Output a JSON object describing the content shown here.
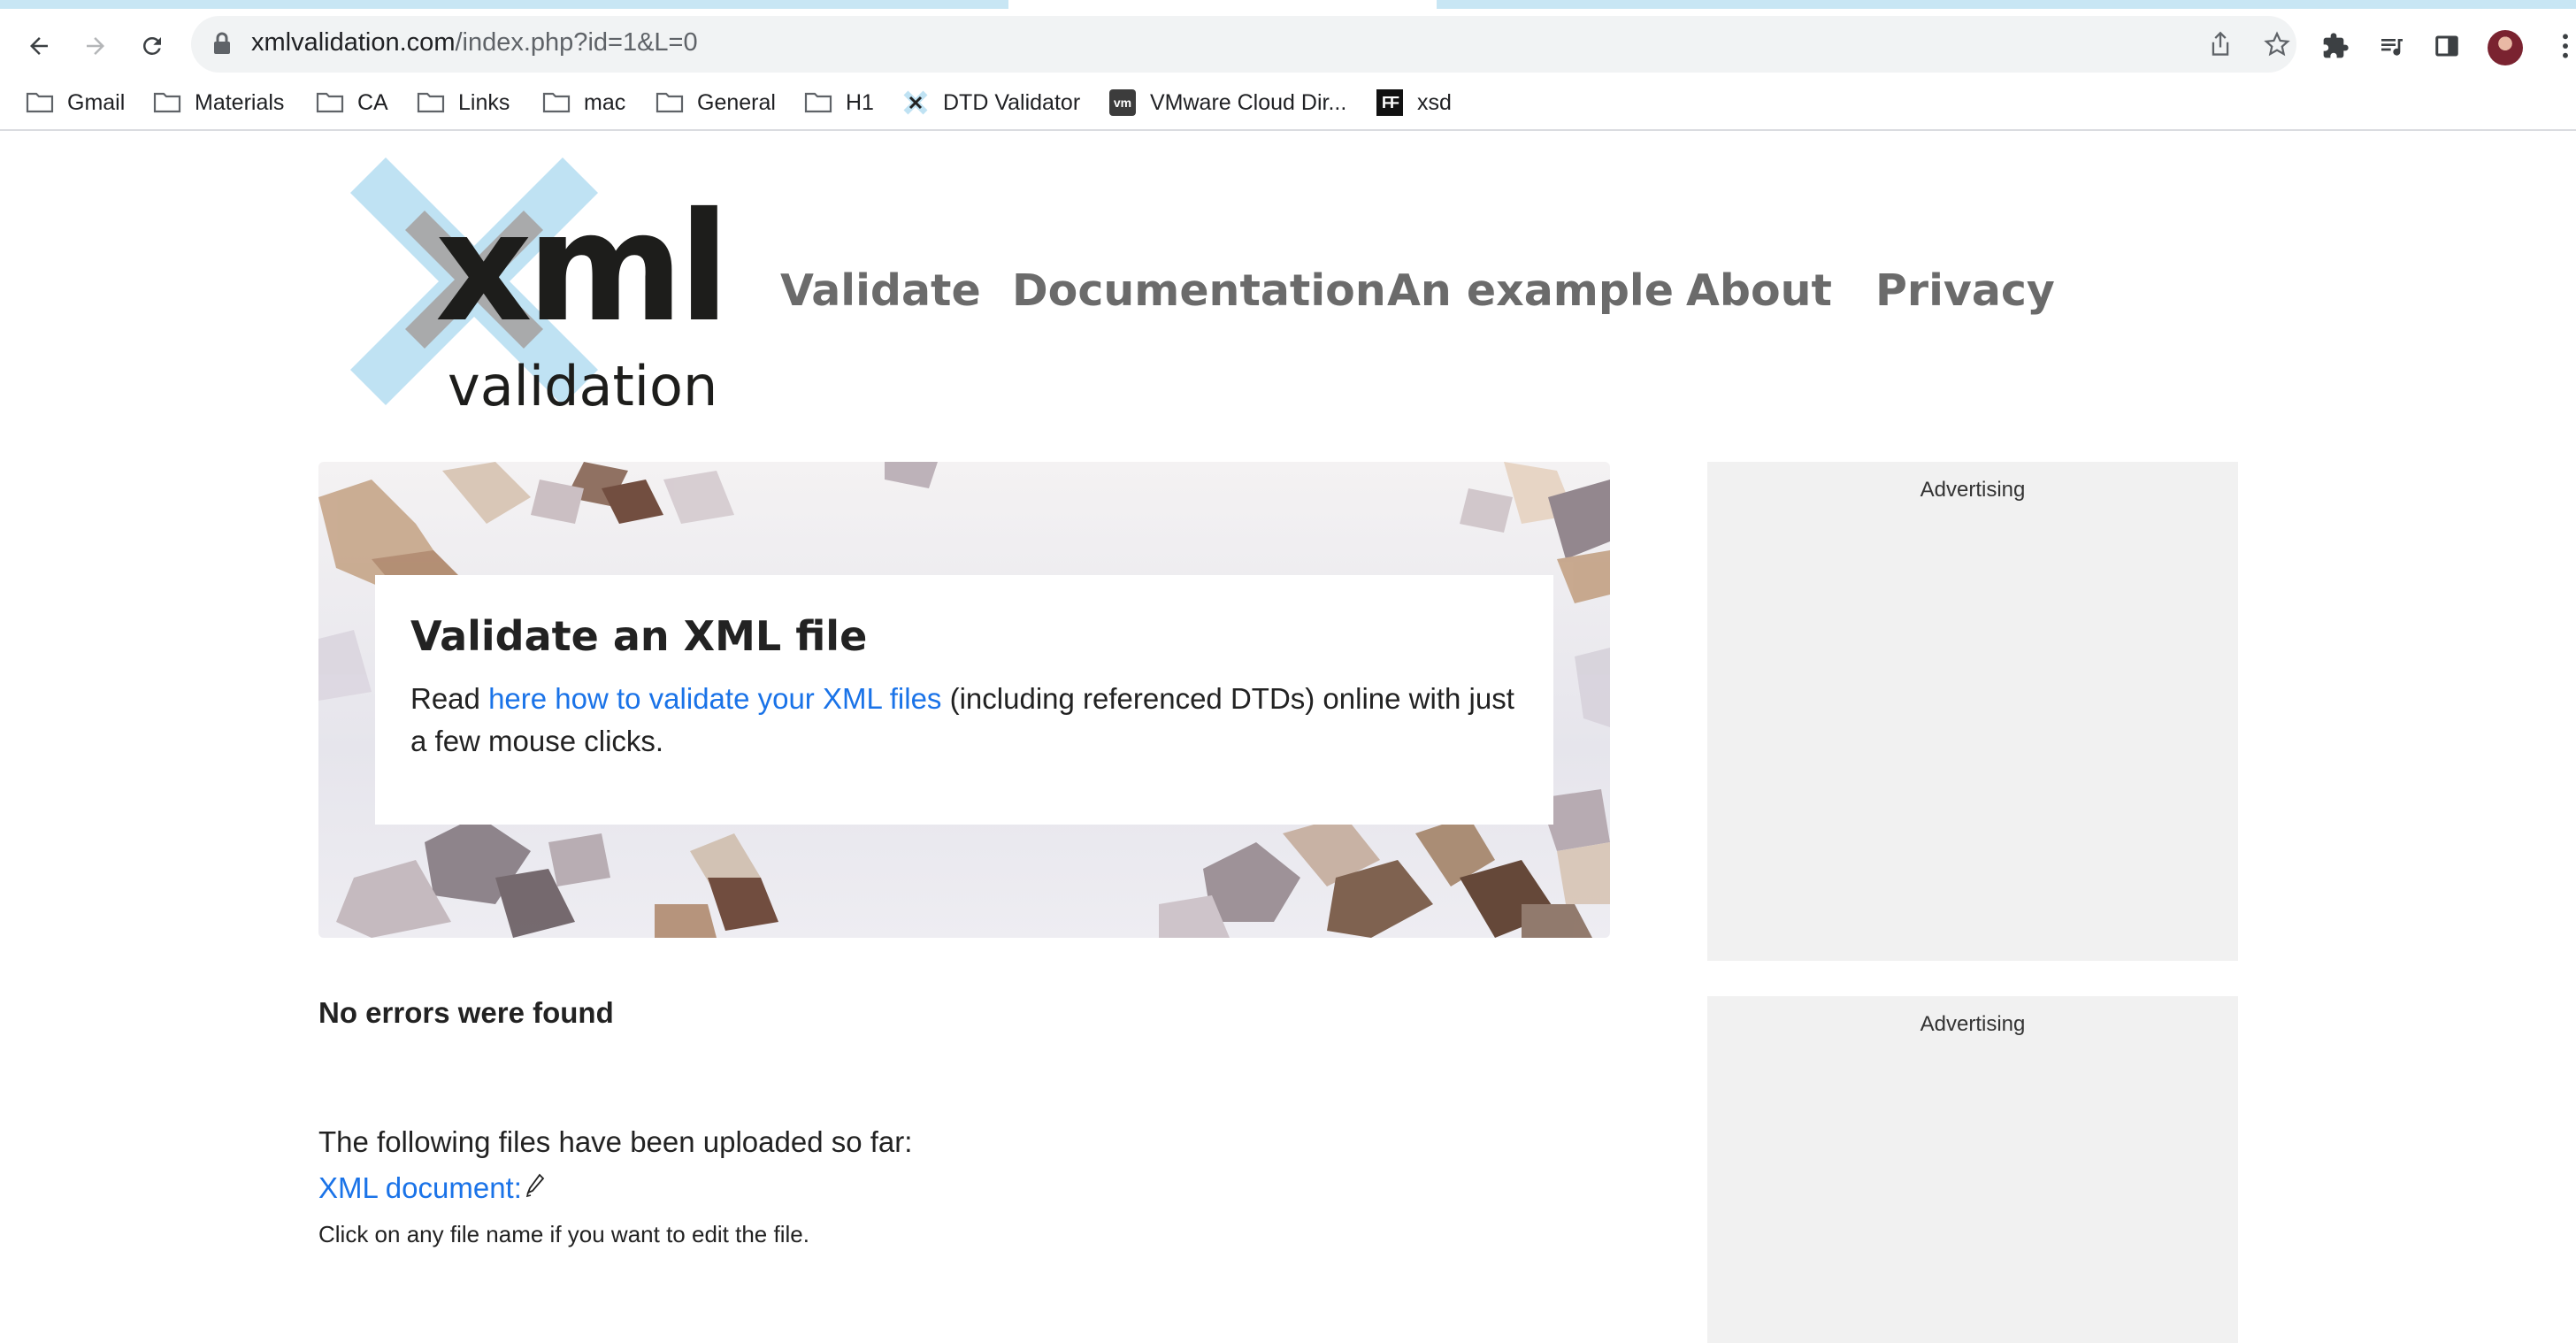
{
  "browser": {
    "url_host": "xmlvalidation.com",
    "url_path": "/index.php?id=1&L=0",
    "bookmarks": [
      {
        "label": "Gmail",
        "icon": "folder-icon"
      },
      {
        "label": "Materials",
        "icon": "folder-icon"
      },
      {
        "label": "CA",
        "icon": "folder-icon"
      },
      {
        "label": "Links",
        "icon": "folder-icon"
      },
      {
        "label": "mac",
        "icon": "folder-icon"
      },
      {
        "label": "General",
        "icon": "folder-icon"
      },
      {
        "label": "H1",
        "icon": "folder-icon"
      },
      {
        "label": "DTD Validator",
        "icon": "xml-favicon"
      },
      {
        "label": "VMware Cloud Dir...",
        "icon": "vmware-favicon",
        "favicon_text": "vm"
      },
      {
        "label": "xsd",
        "icon": "ff-favicon",
        "favicon_text": "FF"
      }
    ]
  },
  "site": {
    "logo": {
      "word_main": "xml",
      "word_sub": "validation"
    },
    "nav": [
      "Validate",
      "Documentation",
      "An example",
      "About",
      "Privacy"
    ]
  },
  "hero": {
    "title": "Validate an XML file",
    "text_before": "Read ",
    "link": "here how to validate your XML files",
    "text_after": " (including referenced DTDs) online with just a few mouse clicks."
  },
  "ads": {
    "label_1": "Advertising",
    "label_2": "Advertising"
  },
  "result": {
    "status": "No errors were found",
    "uploaded_intro": "The following files have been uploaded so far:",
    "file_link": "XML document:",
    "hint": "Click on any file name if you want to edit the file."
  },
  "colors": {
    "link": "#1a73e8",
    "nav": "#6b6b6b",
    "logo_cross": "#bfe2f3",
    "ad_bg": "#f1f1f1"
  }
}
